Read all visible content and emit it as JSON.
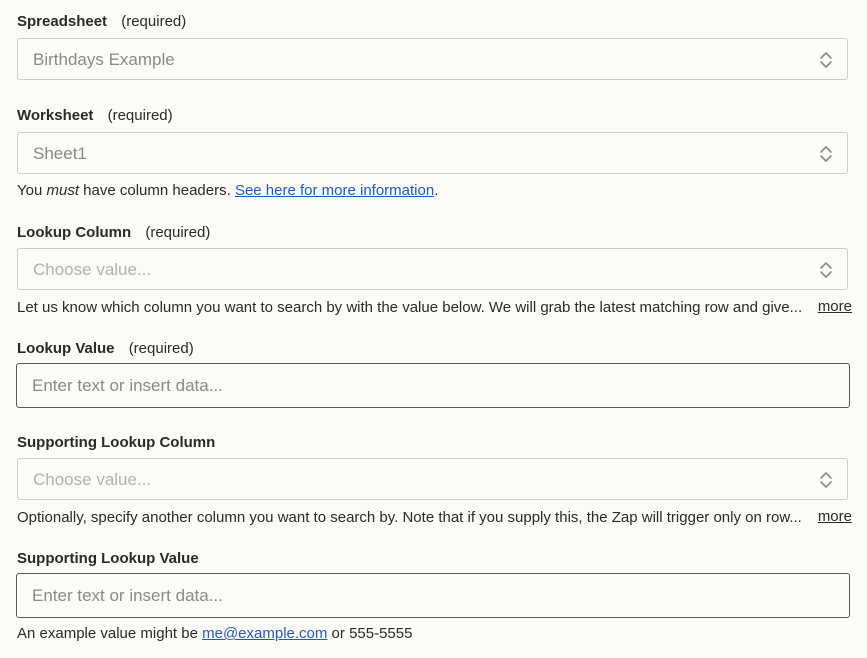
{
  "spreadsheet": {
    "label": "Spreadsheet",
    "required": "(required)",
    "value": "Birthdays Example"
  },
  "worksheet": {
    "label": "Worksheet",
    "required": "(required)",
    "value": "Sheet1",
    "help_prefix": "You ",
    "help_emphasis": "must",
    "help_middle": " have column headers. ",
    "help_link": "See here for more information",
    "help_suffix": "."
  },
  "lookup_column": {
    "label": "Lookup Column",
    "required": "(required)",
    "placeholder": "Choose value...",
    "help": "Let us know which column you want to search by with the value below. We will grab the latest matching row and give...",
    "more": "more"
  },
  "lookup_value": {
    "label": "Lookup Value",
    "required": "(required)",
    "placeholder": "Enter text or insert data..."
  },
  "supporting_lookup_column": {
    "label": "Supporting Lookup Column",
    "placeholder": "Choose value...",
    "help": "Optionally, specify another column you want to search by. Note that if you supply this, the Zap will trigger only on row...",
    "more": "more"
  },
  "supporting_lookup_value": {
    "label": "Supporting Lookup Value",
    "placeholder": "Enter text or insert data...",
    "help_prefix": "An example value might be ",
    "help_link": "me@example.com",
    "help_suffix": " or 555-5555"
  },
  "icons": {
    "select_chevron": "chevron-up-down-icon"
  }
}
